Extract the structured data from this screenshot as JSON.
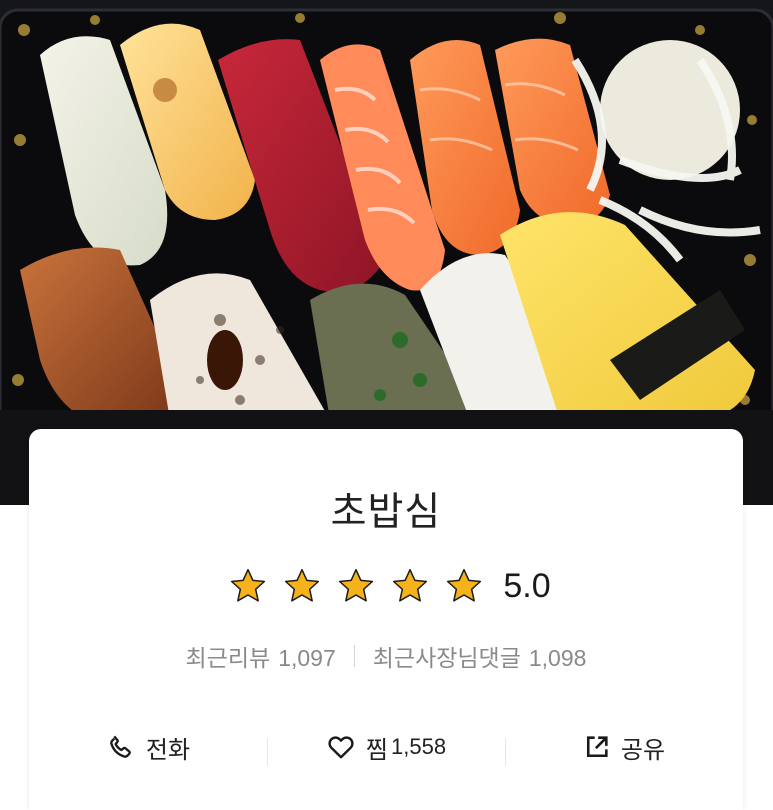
{
  "hero": {
    "image_desc": "sushi-platter-photo"
  },
  "store": {
    "name": "초밥심",
    "rating": {
      "value": "5.0",
      "stars": 5,
      "star_color": "#F5B21B"
    },
    "recent_reviews": {
      "label": "최근리뷰",
      "count": "1,097"
    },
    "owner_replies": {
      "label": "최근사장님댓글",
      "count": "1,098"
    }
  },
  "actions": {
    "call": {
      "label": "전화",
      "icon": "phone-icon"
    },
    "like": {
      "label": "찜",
      "count": "1,558",
      "icon": "heart-icon"
    },
    "share": {
      "label": "공유",
      "icon": "share-icon"
    }
  }
}
